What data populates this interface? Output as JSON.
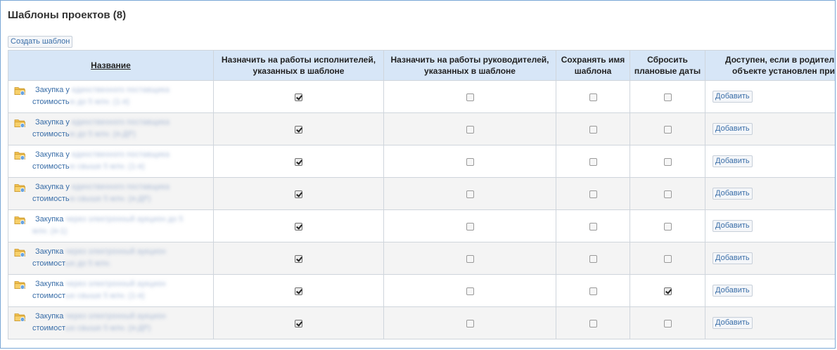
{
  "header": {
    "title": "Шаблоны проектов (8)",
    "create_button": "Создать шаблон"
  },
  "table": {
    "columns": [
      {
        "line1": "Название",
        "line2": ""
      },
      {
        "line1": "Назначить на работы исполнителей,",
        "line2": "указанных в шаблоне"
      },
      {
        "line1": "Назначить на работы руководителей,",
        "line2": "указанных в шаблоне"
      },
      {
        "line1": "Сохранять имя",
        "line2": "шаблона"
      },
      {
        "line1": "Сбросить",
        "line2": "плановые даты"
      },
      {
        "line1": "Доступен, если в родител",
        "line2": "объекте установлен при"
      }
    ],
    "add_label": "Добавить",
    "rows": [
      {
        "name_visible": "Закупка у",
        "name_hidden": "единственного поставщика",
        "line2_visible": "стоимость",
        "line2_hidden": "ю до 5 млн. (1-я)",
        "assign_executors": true,
        "assign_managers": false,
        "keep_name": false,
        "reset_dates": false
      },
      {
        "name_visible": "Закупка у",
        "name_hidden": "единственного поставщика",
        "line2_visible": "стоимость",
        "line2_hidden": "ю до 5 млн. (я-ДР)",
        "assign_executors": true,
        "assign_managers": false,
        "keep_name": false,
        "reset_dates": false
      },
      {
        "name_visible": "Закупка у",
        "name_hidden": "единственного поставщика",
        "line2_visible": "стоимость",
        "line2_hidden": "ю свыше 5 млн. (1-я)",
        "assign_executors": true,
        "assign_managers": false,
        "keep_name": false,
        "reset_dates": false
      },
      {
        "name_visible": "Закупка у",
        "name_hidden": "единственного поставщика",
        "line2_visible": "стоимость",
        "line2_hidden": "ю свыше 5 млн. (я-ДР)",
        "assign_executors": true,
        "assign_managers": false,
        "keep_name": false,
        "reset_dates": false
      },
      {
        "name_visible": "Закупка",
        "name_hidden": "через электронный аукцион до 5",
        "line2_visible": "",
        "line2_hidden": "млн. (я-1)",
        "assign_executors": true,
        "assign_managers": false,
        "keep_name": false,
        "reset_dates": false
      },
      {
        "name_visible": "Закупка",
        "name_hidden": "через электронный аукцион",
        "line2_visible": "стоимост",
        "line2_hidden": "ью до 5 млн.",
        "assign_executors": true,
        "assign_managers": false,
        "keep_name": false,
        "reset_dates": false
      },
      {
        "name_visible": "Закупка",
        "name_hidden": "через электронный аукцион",
        "line2_visible": "стоимост",
        "line2_hidden": "ью свыше 5 млн. (1-я)",
        "assign_executors": true,
        "assign_managers": false,
        "keep_name": false,
        "reset_dates": true
      },
      {
        "name_visible": "Закупка",
        "name_hidden": "через электронный аукцион",
        "line2_visible": "стоимост",
        "line2_hidden": "ью свыше 5 млн. (я-ДР)",
        "assign_executors": true,
        "assign_managers": false,
        "keep_name": false,
        "reset_dates": false
      }
    ]
  },
  "icons": {
    "row_icon": "folder-template-icon"
  },
  "colors": {
    "header_bg": "#d7e6f7",
    "link": "#3a6ea8",
    "frame_border": "#7aa7d6",
    "row_alt": "#f4f4f4"
  }
}
